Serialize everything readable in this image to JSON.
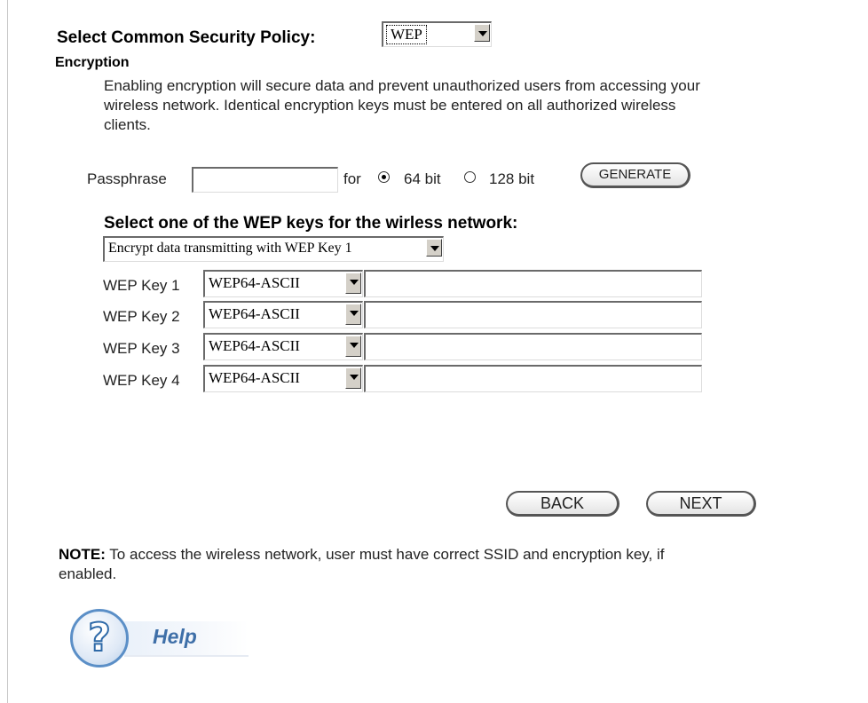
{
  "policy": {
    "label": "Select Common Security Policy:",
    "selected": "WEP"
  },
  "encryption": {
    "heading": "Encryption",
    "description": "Enabling encryption will secure data and prevent unauthorized users from accessing your wireless network. Identical encryption keys must be entered on all authorized wireless clients."
  },
  "passphrase": {
    "label": "Passphrase",
    "value": "",
    "for_label": "for",
    "option_64": "64 bit",
    "option_128": "128 bit",
    "selected_bits": "64 bit",
    "generate_label": "GENERATE"
  },
  "wep": {
    "heading": "Select one of the WEP keys for the wirless network:",
    "key_selector": "Encrypt data transmitting with WEP Key 1",
    "keys": [
      {
        "label": "WEP Key 1",
        "type": "WEP64-ASCII",
        "value": ""
      },
      {
        "label": "WEP Key 2",
        "type": "WEP64-ASCII",
        "value": ""
      },
      {
        "label": "WEP Key 3",
        "type": "WEP64-ASCII",
        "value": ""
      },
      {
        "label": "WEP Key 4",
        "type": "WEP64-ASCII",
        "value": ""
      }
    ]
  },
  "nav": {
    "back_label": "BACK",
    "next_label": "NEXT"
  },
  "note": {
    "prefix": "NOTE:",
    "text": " To access the wireless network, user must have correct SSID and encryption key, if enabled."
  },
  "help": {
    "icon": "question-mark-icon",
    "label": "Help",
    "accent": "#3e6fa8"
  }
}
